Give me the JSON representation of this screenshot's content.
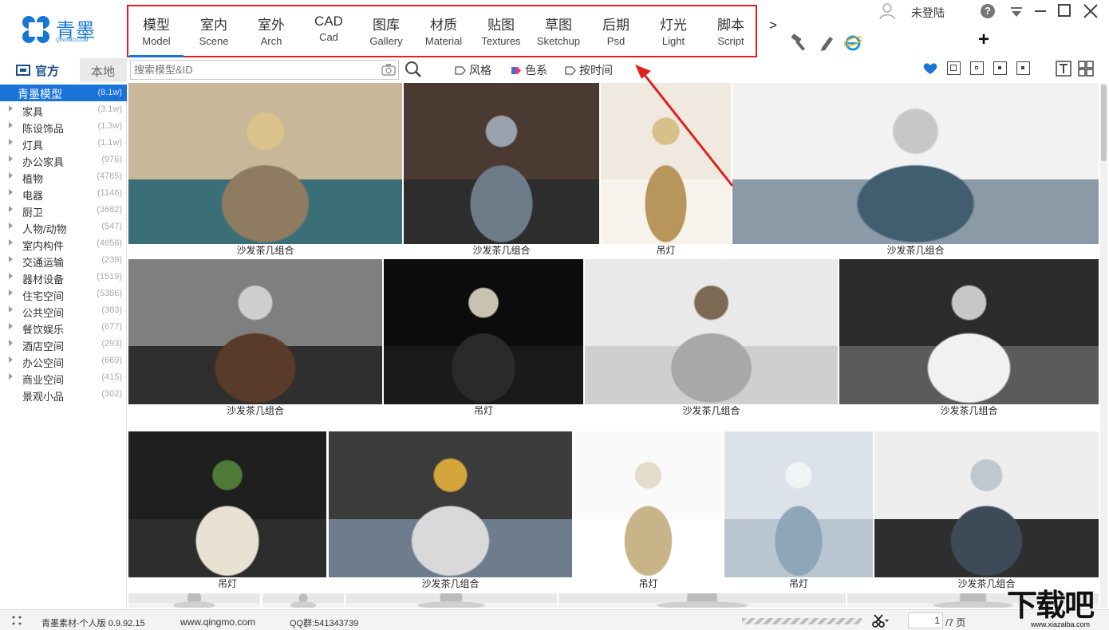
{
  "app": {
    "logo_text": "青墨",
    "logo_sub": "QINGMO.COM"
  },
  "nav": {
    "items": [
      {
        "cn": "模型",
        "en": "Model"
      },
      {
        "cn": "室内",
        "en": "Scene"
      },
      {
        "cn": "室外",
        "en": "Arch"
      },
      {
        "cn": "CAD",
        "en": "Cad"
      },
      {
        "cn": "图库",
        "en": "Gallery"
      },
      {
        "cn": "材质",
        "en": "Material"
      },
      {
        "cn": "贴图",
        "en": "Textures"
      },
      {
        "cn": "草图",
        "en": "Sketchup"
      },
      {
        "cn": "后期",
        "en": "Psd"
      },
      {
        "cn": "灯光",
        "en": "Light"
      },
      {
        "cn": "脚本",
        "en": "Script"
      }
    ],
    "more": ">"
  },
  "user": {
    "label": "未登陆",
    "help": "?",
    "plus": "+"
  },
  "left_tabs": {
    "official": "官方",
    "local": "本地"
  },
  "search": {
    "placeholder": "搜索模型&ID"
  },
  "filters": {
    "style": "风格",
    "color": "色系",
    "time": "按时间"
  },
  "categories": [
    {
      "label": "青墨模型",
      "count": "(8.1w)"
    },
    {
      "label": "家具",
      "count": "(3.1w)"
    },
    {
      "label": "陈设饰品",
      "count": "(1.3w)"
    },
    {
      "label": "灯具",
      "count": "(1.1w)"
    },
    {
      "label": "办公家具",
      "count": "(976)"
    },
    {
      "label": "植物",
      "count": "(4785)"
    },
    {
      "label": "电器",
      "count": "(1146)"
    },
    {
      "label": "厨卫",
      "count": "(3682)"
    },
    {
      "label": "人物/动物",
      "count": "(547)"
    },
    {
      "label": "室内构件",
      "count": "(4656)"
    },
    {
      "label": "交通运输",
      "count": "(239)"
    },
    {
      "label": "器材设备",
      "count": "(1519)"
    },
    {
      "label": "住宅空间",
      "count": "(5386)"
    },
    {
      "label": "公共空间",
      "count": "(383)"
    },
    {
      "label": "餐饮娱乐",
      "count": "(677)"
    },
    {
      "label": "酒店空间",
      "count": "(293)"
    },
    {
      "label": "办公空间",
      "count": "(669)"
    },
    {
      "label": "商业空间",
      "count": "(415)"
    },
    {
      "label": "景观小品",
      "count": "(302)"
    }
  ],
  "thumbnails": [
    {
      "caption": "沙发茶几组合",
      "scene": "living-gold"
    },
    {
      "caption": "沙发茶几组合",
      "scene": "living-grey"
    },
    {
      "caption": "吊灯",
      "scene": "chandelier-leaf"
    },
    {
      "caption": "沙发茶几组合",
      "scene": "living-bright"
    },
    {
      "caption": "沙发茶几组合",
      "scene": "living-brown"
    },
    {
      "caption": "吊灯",
      "scene": "chandelier-crystal"
    },
    {
      "caption": "沙发茶几组合",
      "scene": "living-frames"
    },
    {
      "caption": "沙发茶几组合",
      "scene": "living-dark"
    },
    {
      "caption": "吊灯",
      "scene": "plant-hanging"
    },
    {
      "caption": "沙发茶几组合",
      "scene": "living-art"
    },
    {
      "caption": "吊灯",
      "scene": "chandelier-square"
    },
    {
      "caption": "吊灯",
      "scene": "chandelier-hex"
    },
    {
      "caption": "沙发茶几组合",
      "scene": "living-shelf"
    }
  ],
  "status": {
    "version": "青墨素材-个人版 0.9.92.15",
    "site": "www.qingmo.com",
    "qq": "QQ群:541343739",
    "page": "1",
    "total": "/7 页"
  },
  "watermark": {
    "text": "下载吧",
    "url": "www.xiazaiba.com"
  },
  "colors": {
    "accent": "#1a73d9",
    "highlight_border": "#e0201e"
  }
}
